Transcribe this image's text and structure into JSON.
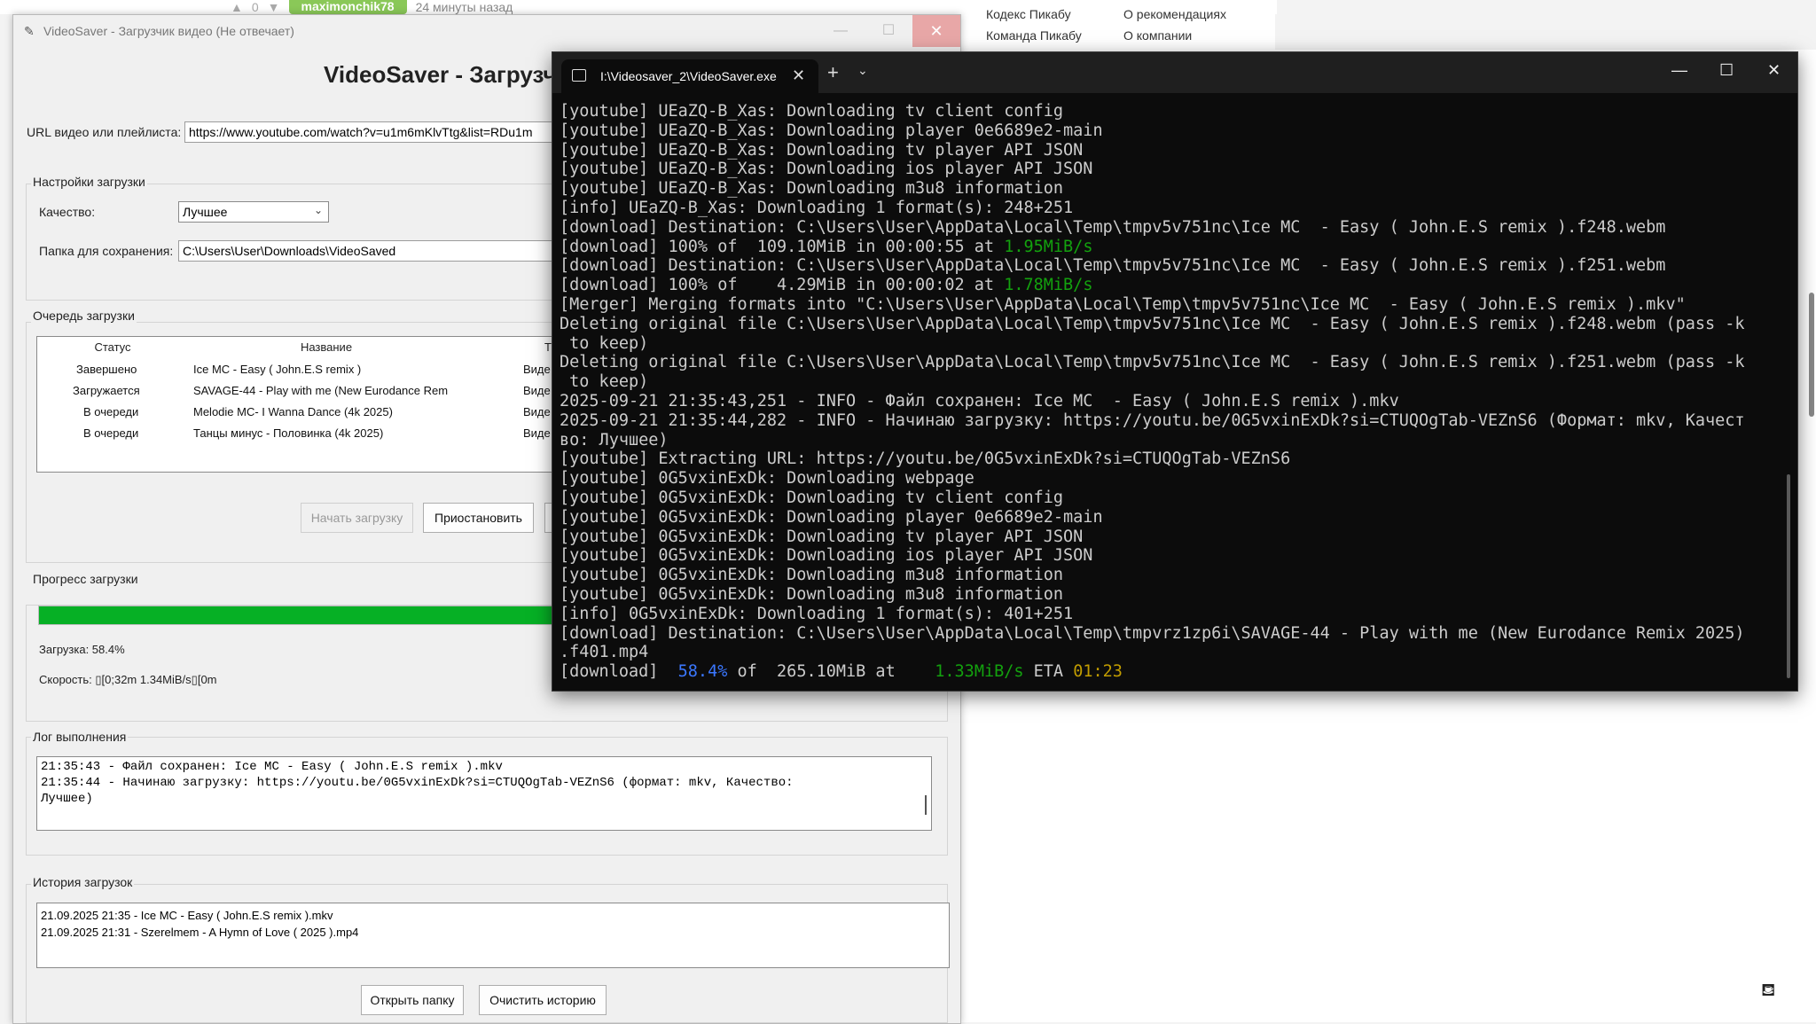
{
  "background": {
    "top_votes": "0",
    "username": "maximonchik78",
    "time_ago": "24 минуты назад",
    "links": [
      "Кодекс Пикабу",
      "Команда Пикабу",
      "О рекомендациях",
      "О компании"
    ]
  },
  "videosaver": {
    "window_title": "VideoSaver - Загрузчик видео (Не отвечает)",
    "heading": "VideoSaver - Загрузч",
    "url_label": "URL видео или плейлиста:",
    "url_value": "https://www.youtube.com/watch?v=u1m6mKlvTtg&list=RDu1m",
    "settings_title": "Настройки загрузки",
    "quality_label": "Качество:",
    "quality_value": "Лучшее",
    "folder_label": "Папка для сохранения:",
    "folder_value": "C:\\Users\\User\\Downloads\\VideoSaved",
    "queue_title": "Очередь загрузки",
    "queue_columns": [
      "Статус",
      "Название",
      "Тип"
    ],
    "queue_rows": [
      {
        "status": "Завершено",
        "name": "Ice MC  - Easy ( John.E.S remix )",
        "type": "Виде"
      },
      {
        "status": "Загружается",
        "name": "SAVAGE-44 - Play with me (New Eurodance Rem",
        "type": "Виде"
      },
      {
        "status": "В очереди",
        "name": "Melodie MC- I Wanna Dance (4k 2025)",
        "type": "Виде"
      },
      {
        "status": "В очереди",
        "name": "Танцы минус - Половинка (4k 2025)",
        "type": "Виде"
      }
    ],
    "start_button": "Начать загрузку",
    "pause_button": "Приостановить",
    "progress_title": "Прогресс загрузки",
    "progress_value": 58.4,
    "progress_text": "Загрузка: 58.4%",
    "speed_text": "Скорость: ▯[0;32m  1.34MiB/s▯[0m",
    "log_title": "Лог выполнения",
    "log_lines": [
      "21:35:43 - Файл сохранен: Ice MC  - Easy ( John.E.S remix ).mkv",
      "21:35:44 - Начинаю загрузку: https://youtu.be/0G5vxinExDk?si=CTUQOgTab-VEZnS6 (формат: mkv, Качество:",
      "Лучшее)"
    ],
    "history_title": "История загрузок",
    "history_lines": [
      "21.09.2025 21:35 - Ice MC  - Easy ( John.E.S remix ).mkv",
      "21.09.2025 21:31 - Szerelmem - A Hymn of Love ( 2025 ).mp4"
    ],
    "open_folder_button": "Открыть папку",
    "clear_history_button": "Очистить историю"
  },
  "terminal": {
    "tab_title": "I:\\Videosaver_2\\VideoSaver.exe",
    "lines": [
      [
        {
          "t": "[youtube] UEaZQ-B_Xas: Downloading tv client config"
        }
      ],
      [
        {
          "t": "[youtube] UEaZQ-B_Xas: Downloading player 0e6689e2-main"
        }
      ],
      [
        {
          "t": "[youtube] UEaZQ-B_Xas: Downloading tv player API JSON"
        }
      ],
      [
        {
          "t": "[youtube] UEaZQ-B_Xas: Downloading ios player API JSON"
        }
      ],
      [
        {
          "t": "[youtube] UEaZQ-B_Xas: Downloading m3u8 information"
        }
      ],
      [
        {
          "t": "[info] UEaZQ-B_Xas: Downloading 1 format(s): 248+251"
        }
      ],
      [
        {
          "t": "[download] Destination: C:\\Users\\User\\AppData\\Local\\Temp\\tmpv5v751nc\\Ice MC  - Easy ( John.E.S remix ).f248.webm"
        }
      ],
      [
        {
          "t": "[download] 100% of  109.10MiB in 00:00:55 at "
        },
        {
          "t": "1.95MiB/s",
          "c": "g"
        }
      ],
      [
        {
          "t": "[download] Destination: C:\\Users\\User\\AppData\\Local\\Temp\\tmpv5v751nc\\Ice MC  - Easy ( John.E.S remix ).f251.webm"
        }
      ],
      [
        {
          "t": "[download] 100% of    4.29MiB in 00:00:02 at "
        },
        {
          "t": "1.78MiB/s",
          "c": "g"
        }
      ],
      [
        {
          "t": "[Merger] Merging formats into \"C:\\Users\\User\\AppData\\Local\\Temp\\tmpv5v751nc\\Ice MC  - Easy ( John.E.S remix ).mkv\""
        }
      ],
      [
        {
          "t": "Deleting original file C:\\Users\\User\\AppData\\Local\\Temp\\tmpv5v751nc\\Ice MC  - Easy ( John.E.S remix ).f248.webm (pass -k"
        }
      ],
      [
        {
          "t": " to keep)"
        }
      ],
      [
        {
          "t": "Deleting original file C:\\Users\\User\\AppData\\Local\\Temp\\tmpv5v751nc\\Ice MC  - Easy ( John.E.S remix ).f251.webm (pass -k"
        }
      ],
      [
        {
          "t": " to keep)"
        }
      ],
      [
        {
          "t": "2025-09-21 21:35:43,251 - INFO - Файл сохранен: Ice MC  - Easy ( John.E.S remix ).mkv"
        }
      ],
      [
        {
          "t": "2025-09-21 21:35:44,282 - INFO - Начинаю загрузку: https://youtu.be/0G5vxinExDk?si=CTUQOgTab-VEZnS6 (Формат: mkv, Качест"
        }
      ],
      [
        {
          "t": "во: Лучшее)"
        }
      ],
      [
        {
          "t": "[youtube] Extracting URL: https://youtu.be/0G5vxinExDk?si=CTUQOgTab-VEZnS6"
        }
      ],
      [
        {
          "t": "[youtube] 0G5vxinExDk: Downloading webpage"
        }
      ],
      [
        {
          "t": "[youtube] 0G5vxinExDk: Downloading tv client config"
        }
      ],
      [
        {
          "t": "[youtube] 0G5vxinExDk: Downloading player 0e6689e2-main"
        }
      ],
      [
        {
          "t": "[youtube] 0G5vxinExDk: Downloading tv player API JSON"
        }
      ],
      [
        {
          "t": "[youtube] 0G5vxinExDk: Downloading ios player API JSON"
        }
      ],
      [
        {
          "t": "[youtube] 0G5vxinExDk: Downloading m3u8 information"
        }
      ],
      [
        {
          "t": "[youtube] 0G5vxinExDk: Downloading m3u8 information"
        }
      ],
      [
        {
          "t": "[info] 0G5vxinExDk: Downloading 1 format(s): 401+251"
        }
      ],
      [
        {
          "t": "[download] Destination: C:\\Users\\User\\AppData\\Local\\Temp\\tmpvrz1zp6i\\SAVAGE-44 - Play with me (New Eurodance Remix 2025)"
        }
      ],
      [
        {
          "t": ".f401.mp4"
        }
      ],
      [
        {
          "t": "[download]  "
        },
        {
          "t": "58.4%",
          "c": "b"
        },
        {
          "t": " of  265.10MiB at    "
        },
        {
          "t": "1.33MiB/s",
          "c": "g"
        },
        {
          "t": " ETA "
        },
        {
          "t": "01:23",
          "c": "y"
        }
      ]
    ]
  },
  "colors": {
    "progress_green": "#06b025",
    "terminal_bg": "#0c0c0c",
    "terminal_green": "#13a10e",
    "terminal_blue": "#3b78ff",
    "terminal_yellow": "#c19c00"
  }
}
